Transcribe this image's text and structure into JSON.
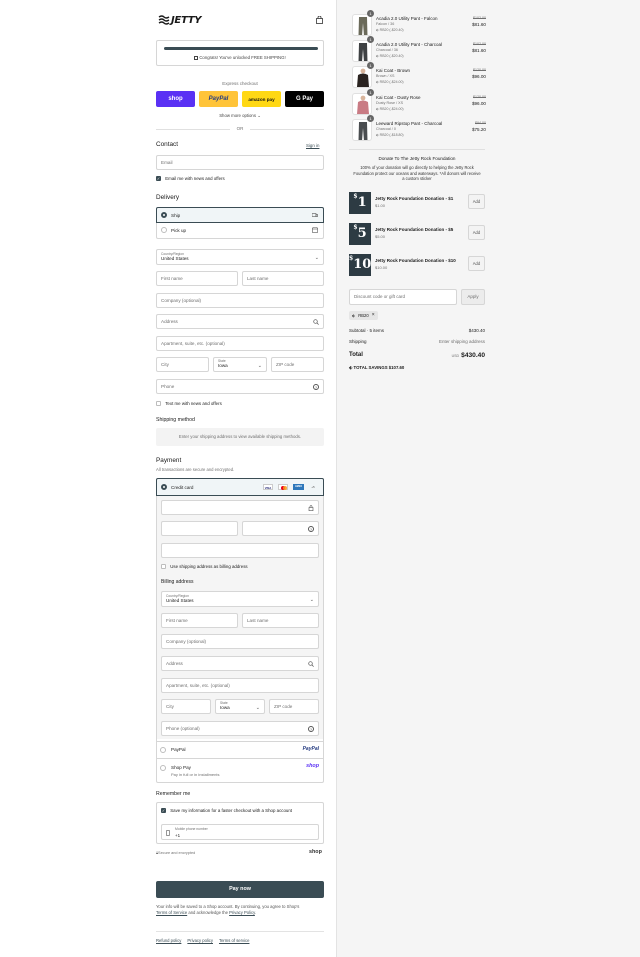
{
  "brand": {
    "name": "JETTY"
  },
  "shipping_banner": {
    "text": "Congrats! You've unlocked FREE SHIPPING!"
  },
  "express": {
    "title": "Express checkout",
    "buttons": [
      {
        "label": "shop",
        "color": "#5a31f4",
        "text_color": "#ffffff"
      },
      {
        "label": "PayPal",
        "color": "#ffc439",
        "text_color": "#253b80"
      },
      {
        "label": "amazon pay",
        "color": "#ffd814",
        "text_color": "#111111"
      },
      {
        "label": "G Pay",
        "color": "#000000",
        "text_color": "#ffffff"
      }
    ],
    "show_more": "Show more options",
    "or": "OR"
  },
  "contact": {
    "title": "Contact",
    "sign_in": "Sign in",
    "email_placeholder": "Email",
    "news_label": "Email me with news and offers"
  },
  "delivery": {
    "title": "Delivery",
    "options": [
      {
        "label": "Ship",
        "selected": true
      },
      {
        "label": "Pick up",
        "selected": false
      }
    ],
    "country_label": "Country/Region",
    "country_value": "United States",
    "first_name": "First name",
    "last_name": "Last name",
    "company": "Company (optional)",
    "address": "Address",
    "apartment": "Apartment, suite, etc. (optional)",
    "city": "City",
    "state_label": "State",
    "state_value": "Iowa",
    "zip": "ZIP code",
    "phone": "Phone",
    "text_me": "Text me with news and offers"
  },
  "shipping_method": {
    "title": "Shipping method",
    "message": "Enter your shipping address to view available shipping methods."
  },
  "payment": {
    "title": "Payment",
    "subtitle": "All transactions are secure and encrypted.",
    "credit_card": "Credit card",
    "card_brands": [
      "VISA",
      "MC",
      "AMEX",
      "+5"
    ],
    "use_shipping": "Use shipping address as billing address",
    "billing_title": "Billing address",
    "country_label": "Country/Region",
    "country_value": "United States",
    "first_name": "First name",
    "last_name": "Last name",
    "company": "Company (optional)",
    "address": "Address",
    "apartment": "Apartment, suite, etc. (optional)",
    "city": "City",
    "state_label": "State",
    "state_value": "Iowa",
    "zip": "ZIP code",
    "phone": "Phone (optional)",
    "paypal": "PayPal",
    "paypal_logo": "PayPal",
    "shoppay": "Shop Pay",
    "shoppay_sub": "Pay in full or in installments",
    "shoppay_logo": "shop"
  },
  "remember": {
    "title": "Remember me",
    "save_label": "Save my information for a faster checkout with a Shop account",
    "mobile_label": "Mobile phone number",
    "mobile_value": "+1",
    "secure": "Secure and encrypted",
    "shop_logo": "shop"
  },
  "pay_button": "Pay now",
  "legal": {
    "text1": "Your info will be saved to a Shop account. By continuing, you agree to Shop's",
    "terms": "Terms of Service",
    "text2": "and acknowledge the",
    "privacy": "Privacy Policy",
    "end": "."
  },
  "footer": {
    "links": [
      "Refund policy",
      "Privacy policy",
      "Terms of service"
    ]
  },
  "cart": {
    "items": [
      {
        "qty": "1",
        "name": "Acadia 2.0 Utility Pant - Falcon",
        "variant": "Falcon / 36",
        "discount": "RB20 (-$20.40)",
        "old_price": "$102.00",
        "price": "$81.60",
        "color": "#6b6a5a"
      },
      {
        "qty": "1",
        "name": "Acadia 2.0 Utility Pant - Charcoal",
        "variant": "Charcoal / 36",
        "discount": "RB20 (-$20.40)",
        "old_price": "$102.00",
        "price": "$81.60",
        "color": "#3e4143"
      },
      {
        "qty": "1",
        "name": "Kai Coat - Brown",
        "variant": "Brown / XS",
        "discount": "RB20 (-$24.00)",
        "old_price": "$120.00",
        "price": "$96.00",
        "color": "#2a2320"
      },
      {
        "qty": "1",
        "name": "Kai Coat - Dusty Rose",
        "variant": "Dusty Rose / XS",
        "discount": "RB20 (-$24.00)",
        "old_price": "$120.00",
        "price": "$96.00",
        "color": "#c97b84"
      },
      {
        "qty": "1",
        "name": "Leeward Ripstop Pant - Charcoal",
        "variant": "Charcoal / 0",
        "discount": "RB20 (-$18.80)",
        "old_price": "$94.00",
        "price": "$75.20",
        "color": "#4a4d50"
      }
    ],
    "donate_title": "Donate To The Jetty Rock Foundation",
    "donate_text": "100% of your donation will go directly to helping the Jetty Rock Foundation protect our oceans and waterways. *All donors will receive a custom sticker",
    "donations": [
      {
        "amount": "1",
        "name": "Jetty Rock Foundation Donation - $1",
        "price": "$1.00",
        "add": "Add"
      },
      {
        "amount": "5",
        "name": "Jetty Rock Foundation Donation - $5",
        "price": "$5.00",
        "add": "Add"
      },
      {
        "amount": "10",
        "name": "Jetty Rock Foundation Donation - $10",
        "price": "$10.00",
        "add": "Add"
      }
    ],
    "discount_placeholder": "Discount code or gift card",
    "apply": "Apply",
    "code_tag": "RB20",
    "subtotal_label": "Subtotal · 5 items",
    "subtotal": "$430.40",
    "shipping_label": "Shipping",
    "shipping_value": "Enter shipping address",
    "total_label": "Total",
    "currency": "USD",
    "total": "$430.40",
    "savings_label": "TOTAL SAVINGS",
    "savings": "$107.60"
  }
}
